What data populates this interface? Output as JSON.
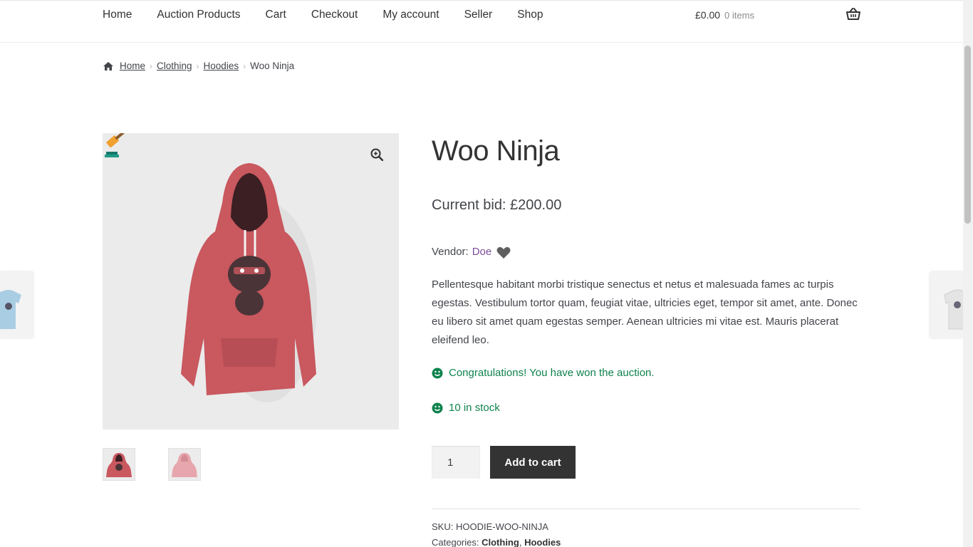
{
  "nav": {
    "items": [
      "Home",
      "Auction Products",
      "Cart",
      "Checkout",
      "My account",
      "Seller",
      "Shop"
    ]
  },
  "cart": {
    "total": "£0.00",
    "count": "0 items"
  },
  "breadcrumb": {
    "home": "Home",
    "clothing": "Clothing",
    "hoodies": "Hoodies",
    "current": "Woo Ninja"
  },
  "product": {
    "title": "Woo Ninja",
    "current_bid": "Current bid: £200.00",
    "vendor_label": "Vendor:",
    "vendor_name": "Doe",
    "description": "Pellentesque habitant morbi tristique senectus et netus et malesuada fames ac turpis egestas. Vestibulum tortor quam, feugiat vitae, ultricies eget, tempor sit amet, ante. Donec eu libero sit amet quam egestas semper. Aenean ultricies mi vitae est. Mauris placerat eleifend leo.",
    "won_notice": "Congratulations! You have won the auction.",
    "stock_notice": "10 in stock",
    "quantity": "1",
    "add_to_cart": "Add to cart",
    "sku_label": "SKU:",
    "sku": "HOODIE-WOO-NINJA",
    "categories_label": "Categories:",
    "category_1": "Clothing",
    "category_sep": ",",
    "category_2": "Hoodies"
  },
  "colors": {
    "accent_green": "#0f834d",
    "vendor_link": "#7d4e9c",
    "button_bg": "#333333",
    "hoodie": "#c9585f"
  },
  "icons": {
    "basket": "basket-icon",
    "home": "home-icon",
    "zoom": "zoom-in-icon",
    "gavel": "gavel-icon",
    "heart": "heart-icon",
    "smile": "smile-icon"
  }
}
